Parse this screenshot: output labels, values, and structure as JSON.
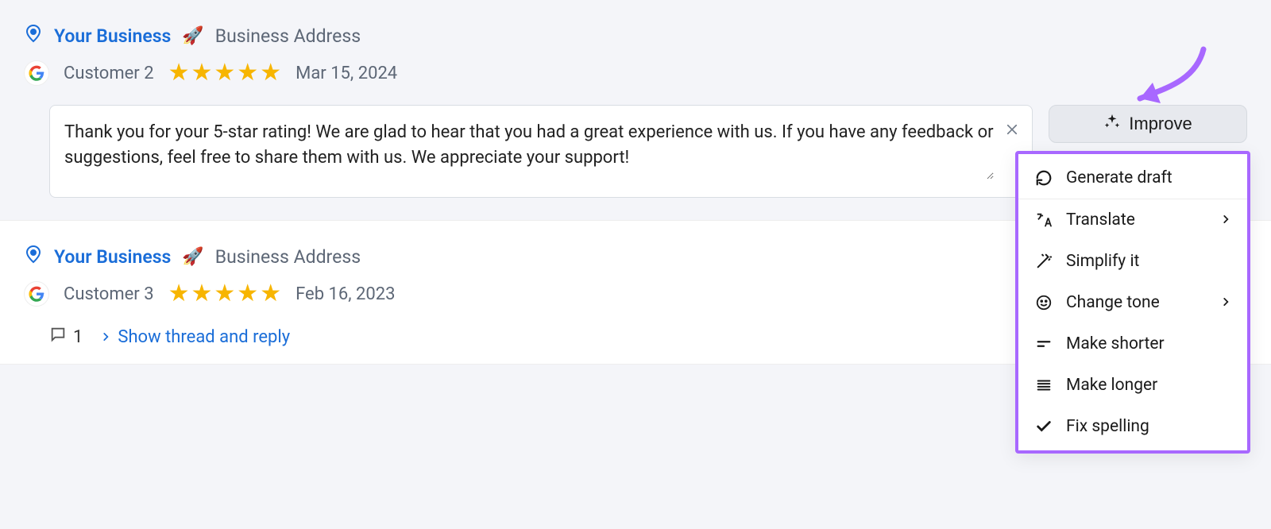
{
  "reviews": [
    {
      "business_name": "Your Business",
      "business_address": "Business Address",
      "customer": "Customer 2",
      "rating": 5,
      "date": "Mar 15, 2024",
      "reply_text": "Thank you for your 5-star rating! We are glad to hear that you had a great experience with us. If you have any feedback or suggestions, feel free to share them with us. We appreciate your support!"
    },
    {
      "business_name": "Your Business",
      "business_address": "Business Address",
      "customer": "Customer 3",
      "rating": 5,
      "date": "Feb 16, 2023",
      "thread_count": "1",
      "show_thread_label": "Show thread and reply"
    }
  ],
  "improve": {
    "button_label": "Improve",
    "menu": {
      "generate": "Generate draft",
      "translate": "Translate",
      "simplify": "Simplify it",
      "tone": "Change tone",
      "shorter": "Make shorter",
      "longer": "Make longer",
      "spelling": "Fix spelling"
    }
  },
  "colors": {
    "link": "#1a6dd8",
    "star": "#f7b500",
    "highlight": "#a868ff"
  }
}
